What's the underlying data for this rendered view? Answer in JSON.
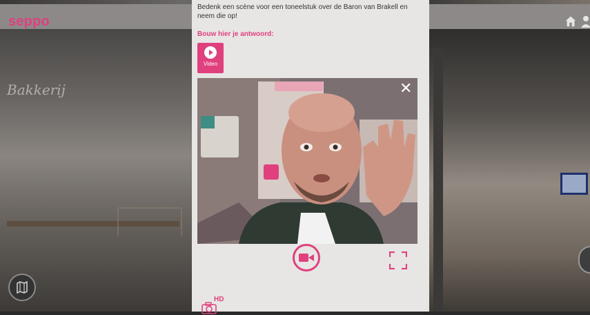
{
  "app": {
    "logo": "seppo"
  },
  "panel": {
    "question": "Bedenk een scène voor een toneelstuk over de Baron van Brakell en neem die op!",
    "answer_label": "Bouw hier je antwoord:",
    "video_button_label": "Video",
    "hd_label": "HD"
  },
  "icons": {
    "home": "home-icon",
    "user": "user-icon",
    "map": "map-icon",
    "close": "close-icon",
    "record": "record-video-icon",
    "fullscreen": "fullscreen-icon",
    "camera_hd": "camera-hd-icon"
  },
  "colors": {
    "accent": "#e0407e"
  }
}
